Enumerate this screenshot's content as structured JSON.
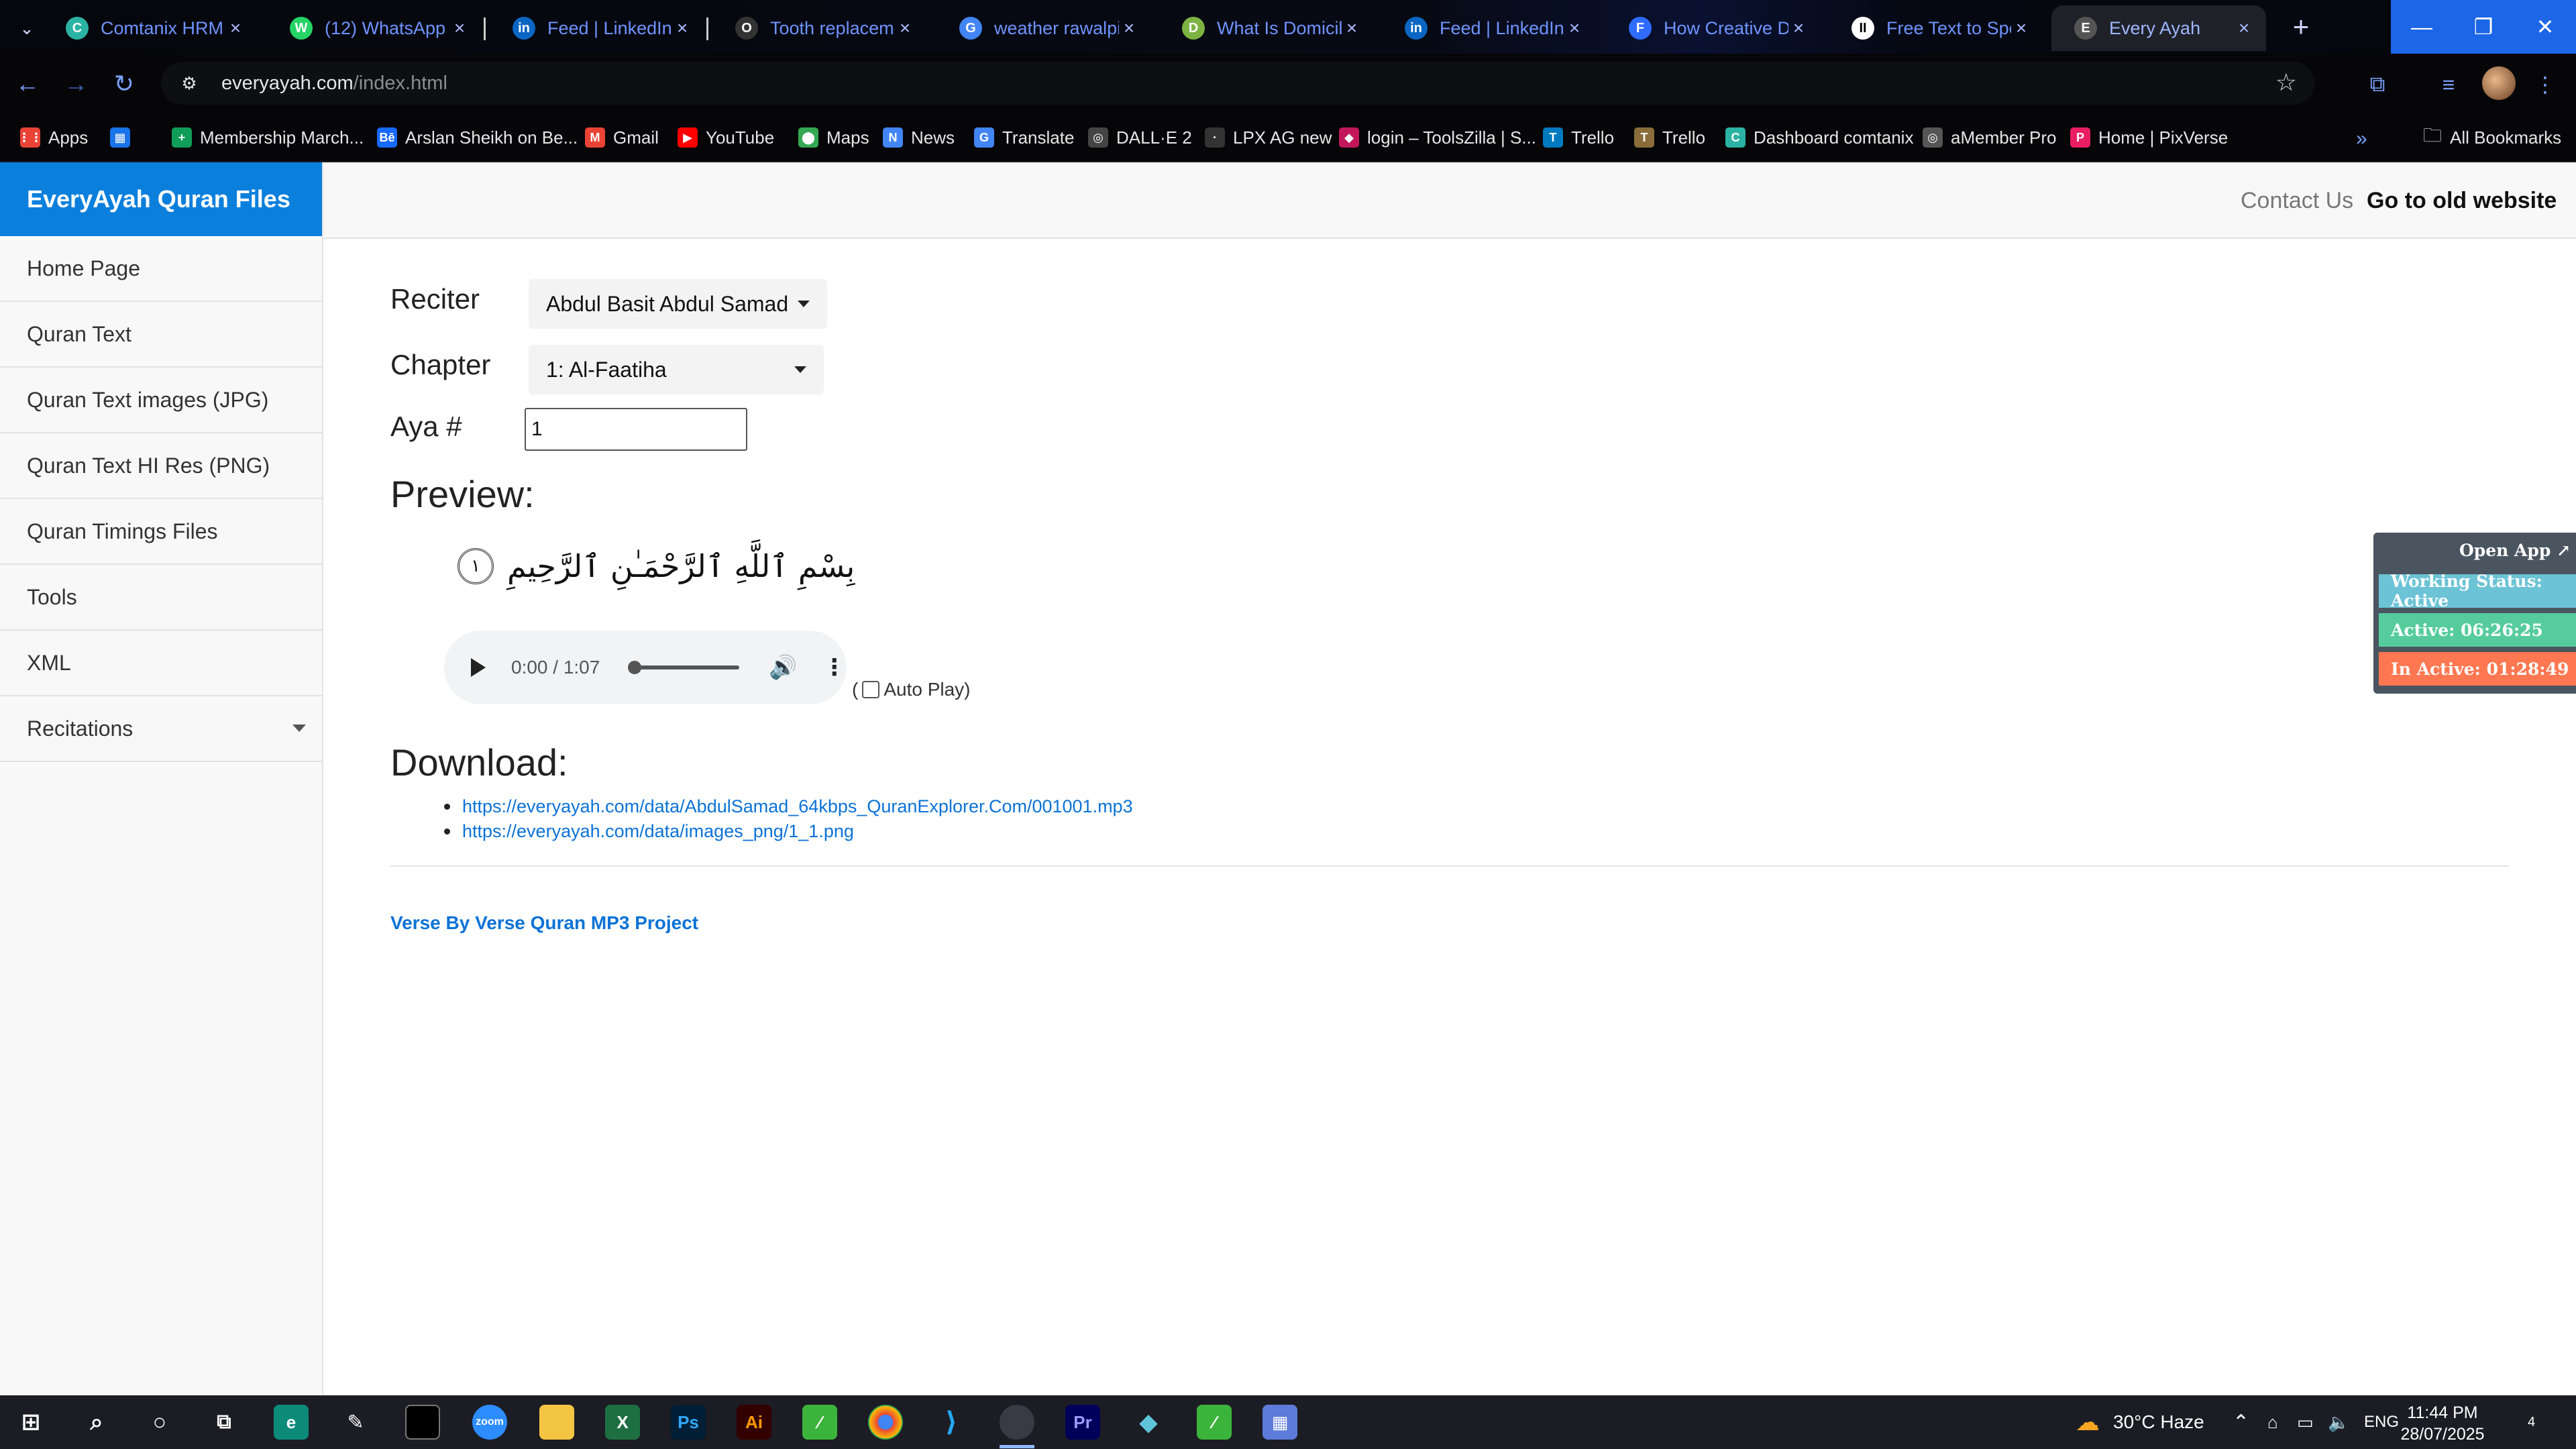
{
  "browser": {
    "tabs": [
      {
        "title": "Comtanix HRM",
        "fav": "C",
        "color": "#2bb3a3"
      },
      {
        "title": "(12) WhatsApp",
        "fav": "W",
        "color": "#25d366"
      },
      {
        "title": "Feed | LinkedIn",
        "fav": "in",
        "color": "#0a66c2"
      },
      {
        "title": "Tooth replaceme",
        "fav": "O",
        "color": "#333333"
      },
      {
        "title": "weather rawalpin",
        "fav": "G",
        "color": "#4285f4"
      },
      {
        "title": "What Is Domicilia",
        "fav": "D",
        "color": "#7cb342"
      },
      {
        "title": "Feed | LinkedIn",
        "fav": "in",
        "color": "#0a66c2"
      },
      {
        "title": "How Creative De",
        "fav": "F",
        "color": "#2f6bff"
      },
      {
        "title": "Free Text to Spee",
        "fav": "II",
        "color": "#ffffff"
      },
      {
        "title": "Every Ayah",
        "fav": "E",
        "color": "#555555"
      }
    ],
    "url_host": "everyayah.com",
    "url_path": "/index.html",
    "bookmarks": [
      {
        "label": "Apps",
        "fav": "⋮⋮",
        "color": "#ea4335"
      },
      {
        "label": "",
        "fav": "▦",
        "color": "#1a73e8"
      },
      {
        "label": "Membership March...",
        "fav": "+",
        "color": "#0f9d58"
      },
      {
        "label": "Arslan Sheikh on Be...",
        "fav": "Bē",
        "color": "#1769ff"
      },
      {
        "label": "Gmail",
        "fav": "M",
        "color": "#ea4335"
      },
      {
        "label": "YouTube",
        "fav": "▶",
        "color": "#ff0000"
      },
      {
        "label": "Maps",
        "fav": "⬤",
        "color": "#34a853"
      },
      {
        "label": "News",
        "fav": "N",
        "color": "#4285f4"
      },
      {
        "label": "Translate",
        "fav": "G",
        "color": "#4285f4"
      },
      {
        "label": "DALL·E 2",
        "fav": "◎",
        "color": "#444444"
      },
      {
        "label": "LPX AG new",
        "fav": "·",
        "color": "#333333"
      },
      {
        "label": "login – ToolsZilla | S...",
        "fav": "◆",
        "color": "#c2185b"
      },
      {
        "label": "Trello",
        "fav": "T",
        "color": "#0079bf"
      },
      {
        "label": "Trello",
        "fav": "T",
        "color": "#8a6d3b"
      },
      {
        "label": "Dashboard comtanix",
        "fav": "C",
        "color": "#2bb3a3"
      },
      {
        "label": "aMember Pro",
        "fav": "◎",
        "color": "#555555"
      },
      {
        "label": "Home | PixVerse",
        "fav": "P",
        "color": "#e91e63"
      }
    ],
    "all_bookmarks": "All Bookmarks"
  },
  "site": {
    "brand": "EveryAyah Quran Files",
    "nav": [
      "Home Page",
      "Quran Text",
      "Quran Text images (JPG)",
      "Quran Text HI Res (PNG)",
      "Quran Timings Files",
      "Tools",
      "XML",
      "Recitations"
    ],
    "top_links": {
      "contact": "Contact Us",
      "old_site": "Go to old website"
    },
    "form": {
      "reciter_label": "Reciter",
      "reciter_value": "Abdul Basit Abdul Samad",
      "chapter_label": "Chapter",
      "chapter_value": "1: Al-Faatiha",
      "aya_label": "Aya #",
      "aya_value": "1"
    },
    "preview_title": "Preview:",
    "verse_text": "بِسْمِ ٱللَّهِ ٱلرَّحْمَـٰنِ ٱلرَّحِيمِ",
    "verse_number": "١",
    "audio": {
      "time": "0:00 / 1:07",
      "autoplay_label": "Auto Play)",
      "autoplay_open": "("
    },
    "download_title": "Download:",
    "downloads": [
      "https://everyayah.com/data/AbdulSamad_64kbps_QuranExplorer.Com/001001.mp3",
      "https://everyayah.com/data/images_png/1_1.png"
    ],
    "footer_link": "Verse By Verse Quran MP3 Project"
  },
  "widget": {
    "open_app": "Open App ↗",
    "status": "Working Status: Active",
    "active": "Active: 06:26:25",
    "inactive": "In Active: 01:28:49",
    "colors": {
      "status": "#6cc3d5",
      "active": "#56cc9d",
      "inactive": "#ff7851"
    }
  },
  "taskbar": {
    "weather": "30°C  Haze",
    "lang": "ENG",
    "time": "11:44 PM",
    "date": "28/07/2025",
    "notifications": "4"
  }
}
